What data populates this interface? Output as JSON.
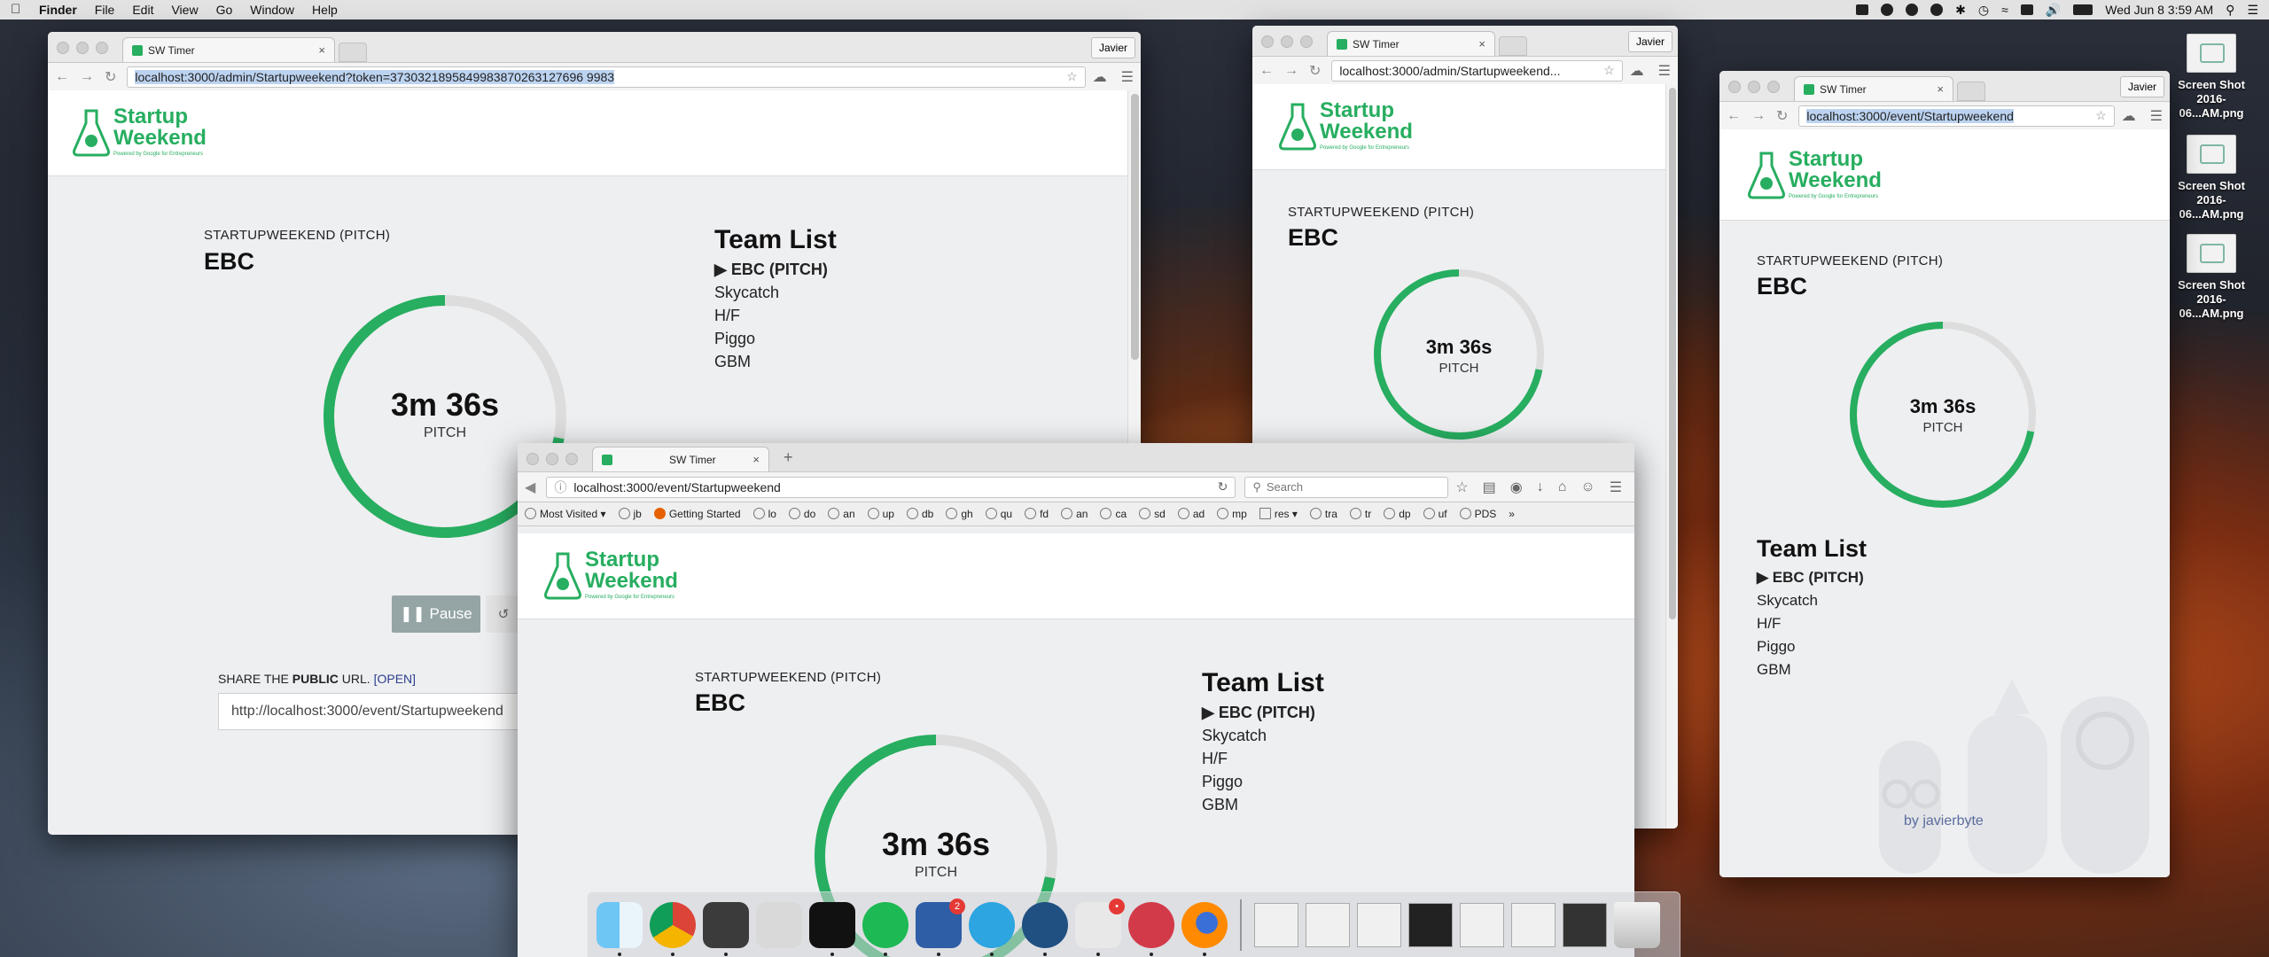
{
  "menubar": {
    "app": "Finder",
    "items": [
      "File",
      "Edit",
      "View",
      "Go",
      "Window",
      "Help"
    ],
    "clock": "Wed Jun 8  3:59 AM"
  },
  "win_admin1": {
    "tab_title": "SW Timer",
    "user": "Javier",
    "url_host": "localhost",
    "url_rest": ":3000/admin/Startupweekend?token=3730321895849983870263127696 9983"
  },
  "win_admin2": {
    "tab_title": "SW Timer",
    "user": "Javier",
    "url": "localhost:3000/admin/Startupweekend..."
  },
  "win_event_chrome": {
    "tab_title": "SW Timer",
    "user": "Javier",
    "url": "localhost:3000/event/Startupweekend"
  },
  "win_firefox": {
    "tab_title": "SW Timer",
    "url": "localhost:3000/event/Startupweekend",
    "search_placeholder": "Search",
    "bookmarks": [
      "Most Visited",
      "jb",
      "Getting Started",
      "lo",
      "do",
      "an",
      "up",
      "db",
      "gh",
      "qu",
      "fd",
      "an",
      "ca",
      "sd",
      "ad",
      "mp",
      "res",
      "tra",
      "tr",
      "dp",
      "uf",
      "PDS"
    ]
  },
  "logo": {
    "line1": "Startup",
    "line2": "Weekend",
    "tagline": "Powered by Google for Entrepreneurs"
  },
  "event": {
    "label": "STARTUPWEEKEND (PITCH)",
    "current": "EBC",
    "timer_value": "3m 36s",
    "timer_label": "PITCH",
    "timer_progress": 0.72
  },
  "teams": {
    "title": "Team List",
    "items": [
      "▶ EBC (PITCH)",
      "Skycatch",
      "H/F",
      "Piggo",
      "GBM"
    ]
  },
  "controls": {
    "pause": "❚❚ Pause",
    "reset": "↺"
  },
  "share": {
    "label_pre": "SHARE THE ",
    "label_bold": "PUBLIC",
    "label_post": " URL. ",
    "open": "[OPEN]",
    "url": "http://localhost:3000/event/Startupweekend"
  },
  "byline": "by javierbyte",
  "desktop_icons": [
    {
      "l1": "Screen Shot",
      "l2": "2016-06...AM.png"
    },
    {
      "l1": "Screen Shot",
      "l2": "2016-06...AM.png"
    },
    {
      "l1": "Screen Shot",
      "l2": "2016-06...AM.png"
    }
  ],
  "colors": {
    "accent_green": "#27ae60",
    "ring_track": "#dddddd",
    "pause_btn": "#95a5a6"
  }
}
